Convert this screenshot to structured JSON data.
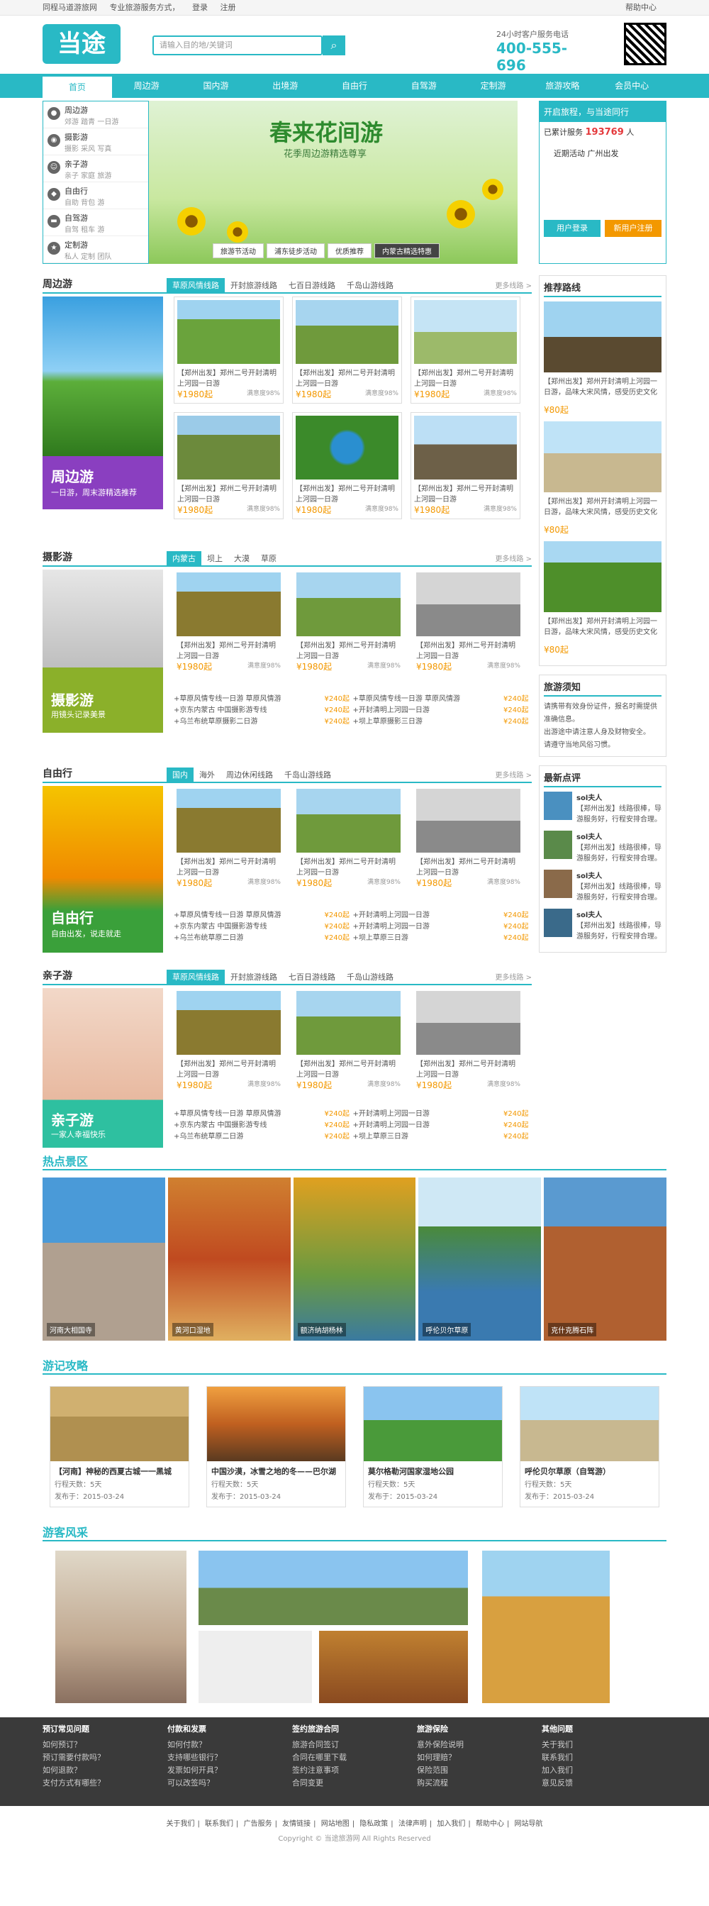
{
  "topbar": {
    "left": [
      "同程马道游旅网",
      "专业旅游服务方式，",
      "登录",
      "注册"
    ],
    "right": [
      "帮助中心"
    ]
  },
  "logo": "当途",
  "search": {
    "placeholder": "请输入目的地/关键词"
  },
  "hotline": {
    "label": "24小时客户服务电话",
    "number": "400-555-696"
  },
  "nav": [
    "首页",
    "周边游",
    "国内游",
    "出境游",
    "自由行",
    "自驾游",
    "定制游",
    "旅游攻略",
    "会员中心"
  ],
  "categories": [
    {
      "name": "周边游",
      "sub": "郊游 踏青 一日游"
    },
    {
      "name": "摄影游",
      "sub": "摄影 采风 写真"
    },
    {
      "name": "亲子游",
      "sub": "亲子 家庭 旅游"
    },
    {
      "name": "自由行",
      "sub": "自助 背包 游"
    },
    {
      "name": "自驾游",
      "sub": "自驾 租车 游"
    },
    {
      "name": "定制游",
      "sub": "私人 定制 团队"
    }
  ],
  "banner": {
    "title": "春来花间游",
    "sub": "花季周边游精选尊享",
    "tabs": [
      "旅游节活动",
      "浦东徒步活动",
      "优质推荐",
      "内蒙古精选特惠"
    ]
  },
  "side": {
    "head": "开启旅程，与当途同行",
    "count_label": "已累计服务",
    "count": "193769",
    "count_unit": "人",
    "line": "近期活动 广州出发",
    "btn1": "用户登录",
    "btn2": "新用户注册"
  },
  "sections": [
    {
      "key": "zby",
      "title": "周边游",
      "tabs": [
        "草原风情线路",
        "开封旅游线路",
        "七百日游线路",
        "千岛山游线路"
      ],
      "more": "更多线路 >",
      "left_big": "周边游",
      "left_small": "一日游，周末游精选推荐",
      "cards": [
        {
          "desc": "【郑州出发】郑州二号开封清明上河园一日游",
          "price": "¥1980起",
          "sold": "满意度98%"
        },
        {
          "desc": "【郑州出发】郑州二号开封清明上河园一日游",
          "price": "¥1980起",
          "sold": "满意度98%"
        },
        {
          "desc": "【郑州出发】郑州二号开封清明上河园一日游",
          "price": "¥1980起",
          "sold": "满意度98%"
        },
        {
          "desc": "【郑州出发】郑州二号开封清明上河园一日游",
          "price": "¥1980起",
          "sold": "满意度98%"
        },
        {
          "desc": "【郑州出发】郑州二号开封清明上河园一日游",
          "price": "¥1980起",
          "sold": "满意度98%"
        },
        {
          "desc": "【郑州出发】郑州二号开封清明上河园一日游",
          "price": "¥1980起",
          "sold": "满意度98%"
        }
      ]
    },
    {
      "key": "sy",
      "title": "摄影游",
      "tabs": [
        "内蒙古",
        "坝上",
        "大漠",
        "草原"
      ],
      "more": "更多线路 >",
      "left_big": "摄影游",
      "left_small": "用镜头记录美景",
      "cards": [
        {
          "desc": "【郑州出发】郑州二号开封清明上河园一日游",
          "price": "¥1980起",
          "sold": "满意度98%"
        },
        {
          "desc": "【郑州出发】郑州二号开封清明上河园一日游",
          "price": "¥1980起",
          "sold": "满意度98%"
        },
        {
          "desc": "【郑州出发】郑州二号开封清明上河园一日游",
          "price": "¥1980起",
          "sold": "满意度98%"
        }
      ],
      "list": [
        [
          "+草原风情专线一日游 草原风情游",
          "¥240起",
          "+草原风情专线一日游 草原风情游",
          "¥240起"
        ],
        [
          "+京东内蒙古 中国摄影游专线",
          "¥240起",
          "+开封清明上河园一日游",
          "¥240起"
        ],
        [
          "+乌兰布统草原摄影二日游",
          "¥240起",
          "+坝上草原摄影三日游",
          "¥240起"
        ]
      ]
    },
    {
      "key": "zyx",
      "title": "自由行",
      "tabs": [
        "国内",
        "海外",
        "周边休闲线路",
        "千岛山游线路"
      ],
      "more": "更多线路 >",
      "left_big": "自由行",
      "left_small": "自由出发，说走就走",
      "cards": [
        {
          "desc": "【郑州出发】郑州二号开封清明上河园一日游",
          "price": "¥1980起",
          "sold": "满意度98%"
        },
        {
          "desc": "【郑州出发】郑州二号开封清明上河园一日游",
          "price": "¥1980起",
          "sold": "满意度98%"
        },
        {
          "desc": "【郑州出发】郑州二号开封清明上河园一日游",
          "price": "¥1980起",
          "sold": "满意度98%"
        }
      ],
      "list": [
        [
          "+草原风情专线一日游 草原风情游",
          "¥240起",
          "+开封清明上河园一日游",
          "¥240起"
        ],
        [
          "+京东内蒙古 中国摄影游专线",
          "¥240起",
          "+开封清明上河园一日游",
          "¥240起"
        ],
        [
          "+乌兰布统草原二日游",
          "¥240起",
          "+坝上草原三日游",
          "¥240起"
        ]
      ]
    },
    {
      "key": "qz",
      "title": "亲子游",
      "tabs": [
        "草原风情线路",
        "开封旅游线路",
        "七百日游线路",
        "千岛山游线路"
      ],
      "more": "更多线路 >",
      "left_big": "亲子游",
      "left_small": "一家人幸福快乐",
      "cards": [
        {
          "desc": "【郑州出发】郑州二号开封清明上河园一日游",
          "price": "¥1980起",
          "sold": "满意度98%"
        },
        {
          "desc": "【郑州出发】郑州二号开封清明上河园一日游",
          "price": "¥1980起",
          "sold": "满意度98%"
        },
        {
          "desc": "【郑州出发】郑州二号开封清明上河园一日游",
          "price": "¥1980起",
          "sold": "满意度98%"
        }
      ],
      "list": [
        [
          "+草原风情专线一日游 草原风情游",
          "¥240起",
          "+开封清明上河园一日游",
          "¥240起"
        ],
        [
          "+京东内蒙古 中国摄影游专线",
          "¥240起",
          "+开封清明上河园一日游",
          "¥240起"
        ],
        [
          "+乌兰布统草原二日游",
          "¥240起",
          "+坝上草原三日游",
          "¥240起"
        ]
      ]
    }
  ],
  "right": {
    "rec_title": "推荐路线",
    "recs": [
      {
        "desc": "【郑州出发】郑州开封清明上河园一日游，品味大宋风情，感受历史文化",
        "price": "¥80起"
      },
      {
        "desc": "【郑州出发】郑州开封清明上河园一日游，品味大宋风情，感受历史文化",
        "price": "¥80起"
      },
      {
        "desc": "【郑州出发】郑州开封清明上河园一日游，品味大宋风情，感受历史文化",
        "price": "¥80起"
      }
    ],
    "tips_title": "旅游须知",
    "tips": [
      "请携带有效身份证件，报名时需提供准确信息。",
      "出游途中请注意人身及财物安全。",
      "请遵守当地风俗习惯。"
    ],
    "news_title": "最新点评",
    "news": [
      {
        "name": "sol夫人",
        "text": "【郑州出发】线路很棒，导游服务好，行程安排合理。"
      },
      {
        "name": "sol夫人",
        "text": "【郑州出发】线路很棒，导游服务好，行程安排合理。"
      },
      {
        "name": "sol夫人",
        "text": "【郑州出发】线路很棒，导游服务好，行程安排合理。"
      },
      {
        "name": "sol夫人",
        "text": "【郑州出发】线路很棒，导游服务好，行程安排合理。"
      }
    ]
  },
  "scenic": {
    "title": "热点景区",
    "items": [
      "河南大相国寺",
      "黄河口湿地",
      "额济纳胡杨林",
      "呼伦贝尔草原",
      "克什克腾石阵"
    ]
  },
  "guide": {
    "title": "游记攻略",
    "items": [
      {
        "title": "【河南】神秘的西夏古城一一黑城",
        "m1": "行程天数：5天",
        "m2": "发布于：2015-03-24"
      },
      {
        "title": "中国沙漠，冰雪之地的冬——巴尔湖",
        "m1": "行程天数：5天",
        "m2": "发布于：2015-03-24"
      },
      {
        "title": "莫尔格勒河国家湿地公园",
        "m1": "行程天数：5天",
        "m2": "发布于：2015-03-24"
      },
      {
        "title": "呼伦贝尔草原（自驾游）",
        "m1": "行程天数：5天",
        "m2": "发布于：2015-03-24"
      }
    ]
  },
  "style": {
    "title": "游客风采"
  },
  "footer": {
    "cols": [
      {
        "h": "预订常见问题",
        "items": [
          "如何预订？",
          "预订需要付款吗？",
          "如何退款？",
          "支付方式有哪些？"
        ]
      },
      {
        "h": "付款和发票",
        "items": [
          "如何付款？",
          "支持哪些银行？",
          "发票如何开具？",
          "可以改签吗？"
        ]
      },
      {
        "h": "签约旅游合同",
        "items": [
          "旅游合同签订",
          "合同在哪里下载",
          "签约注意事项",
          "合同变更"
        ]
      },
      {
        "h": "旅游保险",
        "items": [
          "意外保险说明",
          "如何理赔？",
          "保险范围",
          "购买流程"
        ]
      },
      {
        "h": "其他问题",
        "items": [
          "关于我们",
          "联系我们",
          "加入我们",
          "意见反馈"
        ]
      }
    ]
  },
  "bottom": {
    "links": [
      "关于我们",
      "联系我们",
      "广告服务",
      "友情链接",
      "网站地图",
      "隐私政策",
      "法律声明",
      "加入我们",
      "帮助中心",
      "网站导航"
    ],
    "copy": "Copyright © 当途旅游网 All Rights Reserved"
  }
}
